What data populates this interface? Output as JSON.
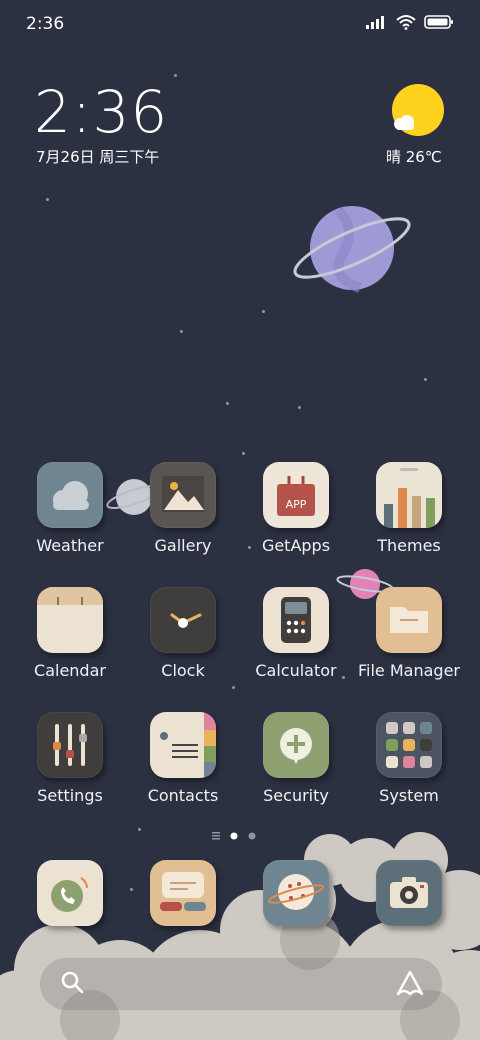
{
  "status_bar": {
    "time": "2:36"
  },
  "clock_widget": {
    "time": "2:36",
    "date": "7月26日 周三下午"
  },
  "weather_widget": {
    "text": "晴 26℃"
  },
  "apps": [
    {
      "label": "Weather",
      "icon": "cloud-icon"
    },
    {
      "label": "Gallery",
      "icon": "mountain-photo-icon"
    },
    {
      "label": "GetApps",
      "icon": "app-store-bag-icon",
      "badge": "APP"
    },
    {
      "label": "Themes",
      "icon": "theme-bars-icon"
    },
    {
      "label": "Calendar",
      "icon": "calendar-icon"
    },
    {
      "label": "Clock",
      "icon": "clock-icon"
    },
    {
      "label": "Calculator",
      "icon": "calculator-icon"
    },
    {
      "label": "File Manager",
      "icon": "folder-icon"
    },
    {
      "label": "Settings",
      "icon": "sliders-icon"
    },
    {
      "label": "Contacts",
      "icon": "contacts-book-icon"
    },
    {
      "label": "Security",
      "icon": "shield-plus-icon"
    },
    {
      "label": "System",
      "icon": "system-folder-icon"
    }
  ],
  "dock": [
    {
      "name": "phone",
      "icon": "phone-icon"
    },
    {
      "name": "messages",
      "icon": "message-icon"
    },
    {
      "name": "browser",
      "icon": "planet-browser-icon"
    },
    {
      "name": "camera",
      "icon": "camera-icon"
    }
  ],
  "colors": {
    "background": "#2c3142",
    "sun": "#ffd21f",
    "planet": "#9e9ad6",
    "pink_planet": "#e083b8"
  }
}
